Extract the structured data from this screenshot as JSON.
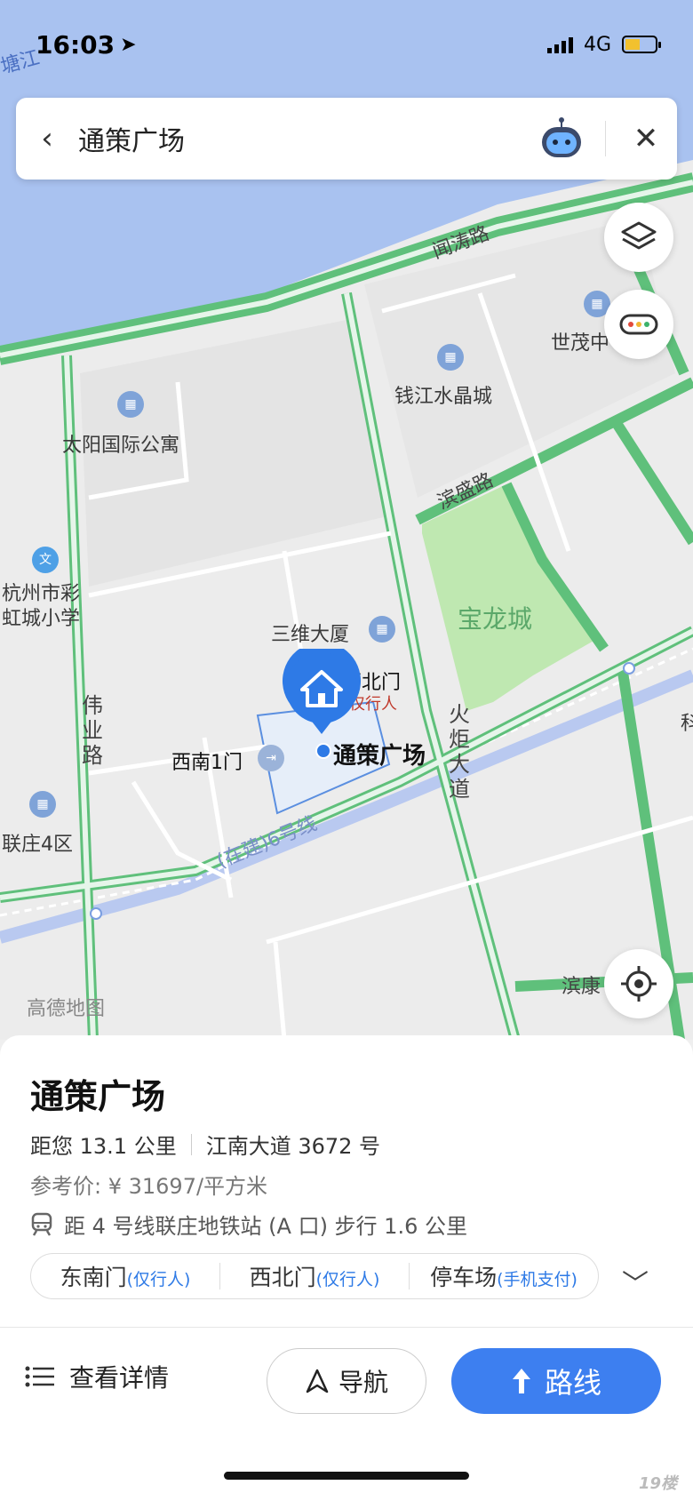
{
  "status_bar": {
    "time": "16:03",
    "network": "4G"
  },
  "search": {
    "query": "通策广场"
  },
  "map": {
    "river_label": "塘江",
    "roads": {
      "wentao": "闻涛路",
      "binsheng": "滨盛路",
      "huoju": "火炬大道",
      "weiye": "伟业路",
      "binkang": "滨康",
      "metro6": "(在建)6号线"
    },
    "pois": {
      "shimao": "世茂中",
      "qianjiang": "钱江水晶城",
      "taiyang": "太阳国际公寓",
      "school": "杭州市彩虹城小学",
      "sanwei": "三维大厦",
      "baolong": "宝龙城",
      "northwest_gate": "西北门",
      "pedestrian": "仅行人",
      "southwest_gate": "西南1门",
      "selected_place": "通策广场",
      "lianzhuang": "联庄4区",
      "edge_he": "科"
    },
    "brand": "高德地图"
  },
  "panel": {
    "title": "通策广场",
    "distance": "距您 13.1 公里",
    "address": "江南大道 3672 号",
    "price": "参考价: ¥ 31697/平方米",
    "metro": "距 4 号线联庄地铁站 (A 口) 步行 1.6 公里",
    "gates": [
      {
        "name": "东南门",
        "note": "(仅行人)"
      },
      {
        "name": "西北门",
        "note": "(仅行人)"
      },
      {
        "name": "停车场",
        "note": "(手机支付)"
      }
    ],
    "details": "查看详情",
    "navigate": "导航",
    "route": "路线"
  },
  "watermark": "19楼"
}
